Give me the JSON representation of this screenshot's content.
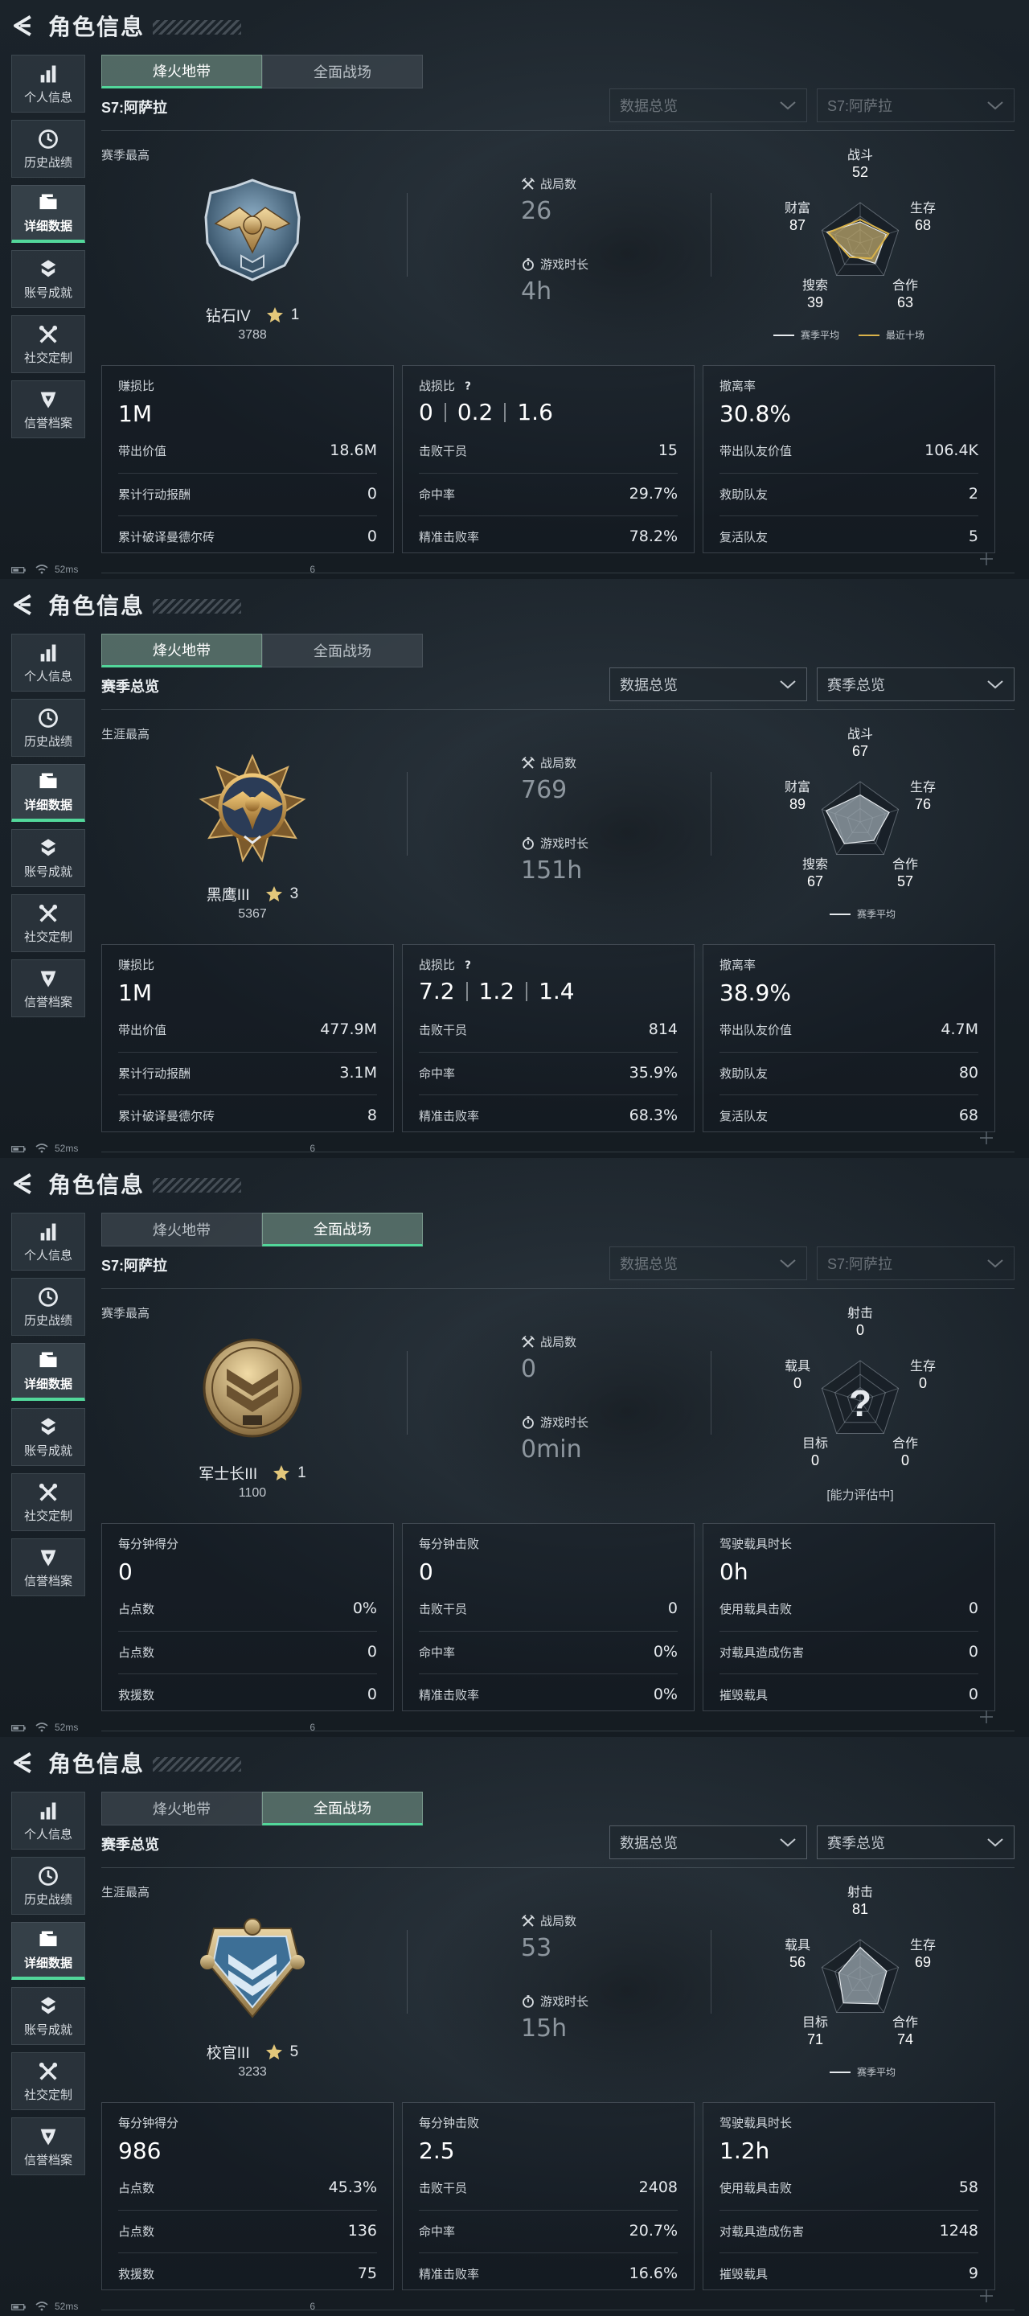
{
  "panels": [
    {
      "title": "角色信息",
      "sidebar": [
        "个人信息",
        "历史战绩",
        "详细数据",
        "账号成就",
        "社交定制",
        "信誉档案"
      ],
      "tabs": [
        "烽火地带",
        "全面战场"
      ],
      "active_tab": 0,
      "season": "S7:阿萨拉",
      "dropdowns": [
        "数据总览",
        "S7:阿萨拉"
      ],
      "dropdowns_dim": true,
      "sub_label": "赛季最高",
      "rank": {
        "name": "钻石IV",
        "stars": "1",
        "score": "3788",
        "style": "diamond"
      },
      "metrics": [
        {
          "label": "战局数",
          "value": "26"
        },
        {
          "label": "游戏时长",
          "value": "4h"
        }
      ],
      "radar": {
        "labels": [
          "战斗",
          "生存",
          "合作",
          "搜索",
          "财富"
        ],
        "values": [
          "52",
          "68",
          "63",
          "39",
          "87"
        ],
        "levels": [
          0.52,
          0.68,
          0.63,
          0.39,
          0.87
        ],
        "recent_levels": [
          0.58,
          0.74,
          0.48,
          0.44,
          0.83
        ],
        "legend": [
          "赛季平均",
          "最近十场"
        ],
        "unknown": false,
        "assess": ""
      },
      "cards": [
        {
          "head": "赚损比",
          "help": false,
          "value": "1M",
          "ratios": [],
          "rows": [
            [
              "带出价值",
              "18.6M"
            ],
            [
              "累计行动报酬",
              "0"
            ],
            [
              "累计破译曼德尔砖",
              "0"
            ]
          ]
        },
        {
          "head": "战损比",
          "help": true,
          "value": "",
          "ratios": [
            "0",
            "0.2",
            "1.6"
          ],
          "rows": [
            [
              "击败干员",
              "15"
            ],
            [
              "命中率",
              "29.7%"
            ],
            [
              "精准击败率",
              "78.2%"
            ]
          ]
        },
        {
          "head": "撤离率",
          "help": false,
          "value": "30.8%",
          "ratios": [],
          "rows": [
            [
              "带出队友价值",
              "106.4K"
            ],
            [
              "救助队友",
              "2"
            ],
            [
              "复活队友",
              "5"
            ]
          ]
        }
      ],
      "status": {
        "ping": "52ms",
        "tail": "6"
      }
    },
    {
      "title": "角色信息",
      "sidebar": [
        "个人信息",
        "历史战绩",
        "详细数据",
        "账号成就",
        "社交定制",
        "信誉档案"
      ],
      "tabs": [
        "烽火地带",
        "全面战场"
      ],
      "active_tab": 0,
      "season": "赛季总览",
      "dropdowns": [
        "数据总览",
        "赛季总览"
      ],
      "dropdowns_dim": false,
      "sub_label": "生涯最高",
      "rank": {
        "name": "黑鹰III",
        "stars": "3",
        "score": "5367",
        "style": "blackhawk"
      },
      "metrics": [
        {
          "label": "战局数",
          "value": "769"
        },
        {
          "label": "游戏时长",
          "value": "151h"
        }
      ],
      "radar": {
        "labels": [
          "战斗",
          "生存",
          "合作",
          "搜索",
          "财富"
        ],
        "values": [
          "67",
          "76",
          "57",
          "67",
          "89"
        ],
        "levels": [
          0.67,
          0.76,
          0.57,
          0.67,
          0.89
        ],
        "recent_levels": [],
        "legend": [
          "赛季平均"
        ],
        "unknown": false,
        "assess": ""
      },
      "cards": [
        {
          "head": "赚损比",
          "help": false,
          "value": "1M",
          "ratios": [],
          "rows": [
            [
              "带出价值",
              "477.9M"
            ],
            [
              "累计行动报酬",
              "3.1M"
            ],
            [
              "累计破译曼德尔砖",
              "8"
            ]
          ]
        },
        {
          "head": "战损比",
          "help": true,
          "value": "",
          "ratios": [
            "7.2",
            "1.2",
            "1.4"
          ],
          "rows": [
            [
              "击败干员",
              "814"
            ],
            [
              "命中率",
              "35.9%"
            ],
            [
              "精准击败率",
              "68.3%"
            ]
          ]
        },
        {
          "head": "撤离率",
          "help": false,
          "value": "38.9%",
          "ratios": [],
          "rows": [
            [
              "带出队友价值",
              "4.7M"
            ],
            [
              "救助队友",
              "80"
            ],
            [
              "复活队友",
              "68"
            ]
          ]
        }
      ],
      "status": {
        "ping": "52ms",
        "tail": "6"
      }
    },
    {
      "title": "角色信息",
      "sidebar": [
        "个人信息",
        "历史战绩",
        "详细数据",
        "账号成就",
        "社交定制",
        "信誉档案"
      ],
      "tabs": [
        "烽火地带",
        "全面战场"
      ],
      "active_tab": 1,
      "season": "S7:阿萨拉",
      "dropdowns": [
        "数据总览",
        "S7:阿萨拉"
      ],
      "dropdowns_dim": true,
      "sub_label": "赛季最高",
      "rank": {
        "name": "军士长III",
        "stars": "1",
        "score": "1100",
        "style": "sergeant"
      },
      "metrics": [
        {
          "label": "战局数",
          "value": "0"
        },
        {
          "label": "游戏时长",
          "value": "0min"
        }
      ],
      "radar": {
        "labels": [
          "射击",
          "生存",
          "合作",
          "目标",
          "载具"
        ],
        "values": [
          "0",
          "0",
          "0",
          "0",
          "0"
        ],
        "levels": [],
        "recent_levels": [],
        "legend": [],
        "unknown": true,
        "assess": "[能力评估中]"
      },
      "cards": [
        {
          "head": "每分钟得分",
          "help": false,
          "value": "0",
          "ratios": [],
          "rows": [
            [
              "占点数",
              "0%"
            ],
            [
              "占点数",
              "0"
            ],
            [
              "救援数",
              "0"
            ]
          ]
        },
        {
          "head": "每分钟击败",
          "help": false,
          "value": "0",
          "ratios": [],
          "rows": [
            [
              "击败干员",
              "0"
            ],
            [
              "命中率",
              "0%"
            ],
            [
              "精准击败率",
              "0%"
            ]
          ]
        },
        {
          "head": "驾驶载具时长",
          "help": false,
          "value": "0h",
          "ratios": [],
          "rows": [
            [
              "使用载具击败",
              "0"
            ],
            [
              "对载具造成伤害",
              "0"
            ],
            [
              "摧毁载具",
              "0"
            ]
          ]
        }
      ],
      "status": {
        "ping": "52ms",
        "tail": "6"
      }
    },
    {
      "title": "角色信息",
      "sidebar": [
        "个人信息",
        "历史战绩",
        "详细数据",
        "账号成就",
        "社交定制",
        "信誉档案"
      ],
      "tabs": [
        "烽火地带",
        "全面战场"
      ],
      "active_tab": 1,
      "season": "赛季总览",
      "dropdowns": [
        "数据总览",
        "赛季总览"
      ],
      "dropdowns_dim": false,
      "sub_label": "生涯最高",
      "rank": {
        "name": "校官III",
        "stars": "5",
        "score": "3233",
        "style": "officer"
      },
      "metrics": [
        {
          "label": "战局数",
          "value": "53"
        },
        {
          "label": "游戏时长",
          "value": "15h"
        }
      ],
      "radar": {
        "labels": [
          "射击",
          "生存",
          "合作",
          "目标",
          "载具"
        ],
        "values": [
          "81",
          "69",
          "74",
          "71",
          "56"
        ],
        "levels": [
          0.81,
          0.69,
          0.74,
          0.71,
          0.56
        ],
        "recent_levels": [],
        "legend": [
          "赛季平均"
        ],
        "unknown": false,
        "assess": ""
      },
      "cards": [
        {
          "head": "每分钟得分",
          "help": false,
          "value": "986",
          "ratios": [],
          "rows": [
            [
              "占点数",
              "45.3%"
            ],
            [
              "占点数",
              "136"
            ],
            [
              "救援数",
              "75"
            ]
          ]
        },
        {
          "head": "每分钟击败",
          "help": false,
          "value": "2.5",
          "ratios": [],
          "rows": [
            [
              "击败干员",
              "2408"
            ],
            [
              "命中率",
              "20.7%"
            ],
            [
              "精准击败率",
              "16.6%"
            ]
          ]
        },
        {
          "head": "驾驶载具时长",
          "help": false,
          "value": "1.2h",
          "ratios": [],
          "rows": [
            [
              "使用载具击败",
              "58"
            ],
            [
              "对载具造成伤害",
              "1248"
            ],
            [
              "摧毁载具",
              "9"
            ]
          ]
        }
      ],
      "status": {
        "ping": "52ms",
        "tail": "6"
      }
    }
  ],
  "colors": {
    "accent_green": "#52d79a",
    "radar_recent": "#d9b24a",
    "radar_fill_gold": "#b9a46a",
    "radar_fill_grey": "#9aa6ae"
  },
  "icons": {
    "back": "back-arrow-icon",
    "sidebar": [
      "bar-chart-icon",
      "clock-icon",
      "folder-icon",
      "achievement-icon",
      "tools-icon",
      "shield-icon"
    ],
    "metrics": [
      "crossed-swords-icon",
      "stopwatch-icon"
    ],
    "help": "question-icon",
    "star": "star-icon",
    "dropdown": "chevron-down-icon"
  }
}
